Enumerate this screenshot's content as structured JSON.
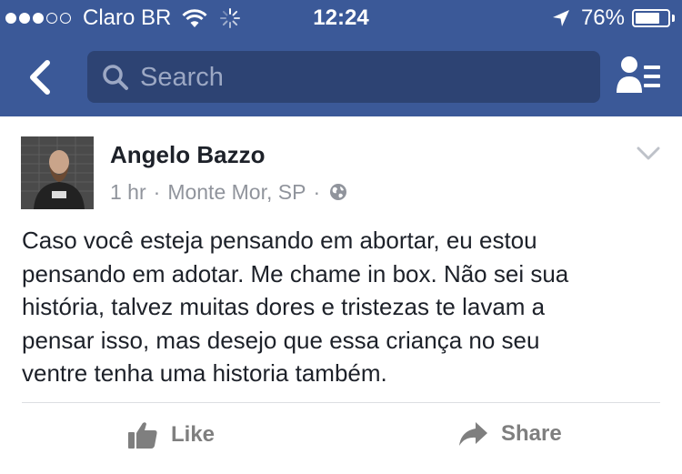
{
  "status_bar": {
    "carrier": "Claro BR",
    "time": "12:24",
    "battery_percent_label": "76%",
    "battery_level": 0.76,
    "signal_bars": 3,
    "signal_bars_total": 5
  },
  "nav": {
    "search_placeholder": "Search",
    "color": "#3b5998"
  },
  "post": {
    "author": "Angelo Bazzo",
    "time": "1 hr",
    "separator": "·",
    "location": "Monte Mor, SP",
    "privacy_icon": "globe-icon",
    "text": "Caso você esteja pensando em abortar, eu estou\npensando em adotar. Me chame in box. Não sei sua\nhistória, talvez muitas dores e tristezas te lavam a\npensar isso, mas desejo que essa criança no seu\nventre tenha uma historia também.",
    "actions": {
      "like_label": "Like",
      "share_label": "Share"
    }
  }
}
